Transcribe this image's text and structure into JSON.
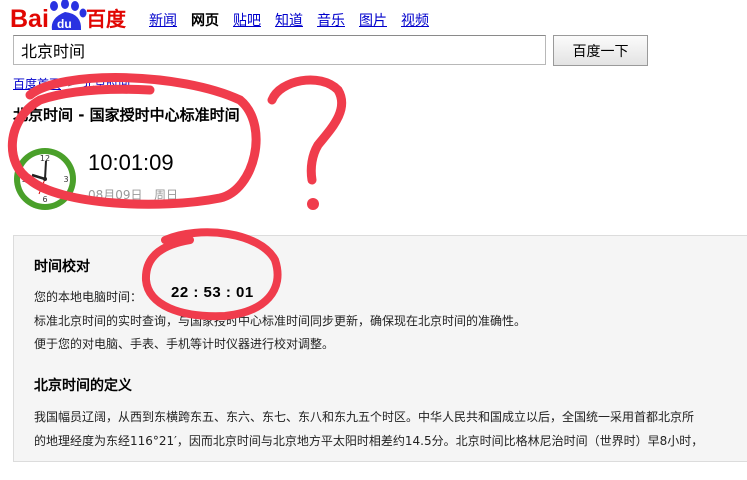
{
  "logo": {
    "text_left": "Bai",
    "text_paw": "du",
    "text_right": "百度"
  },
  "nav": [
    "新闻",
    "网页",
    "贴吧",
    "知道",
    "音乐",
    "图片",
    "视频"
  ],
  "nav_active_index": 1,
  "search": {
    "value": "北京时间",
    "button": "百度一下"
  },
  "breadcrumb": {
    "home": "百度首页",
    "current": "北京时间",
    "separator": ">"
  },
  "result": {
    "title": "北京时间 - 国家授时中心标准时间",
    "time": "10:01:09",
    "date": "08月09日",
    "weekday": "周日"
  },
  "panel": {
    "calibration_heading": "时间校对",
    "local_label": "您的本地电脑时间：",
    "local_time": "22 : 53 : 01",
    "line1": "标准北京时间的实时查询，与国家授时中心标准时间同步更新，确保现在北京时间的准确性。",
    "line2": "便于您的对电脑、手表、手机等计时仪器进行校对调整。",
    "definition_heading": "北京时间的定义",
    "def1": "我国幅员辽阔，从西到东横跨东五、东六、东七、东八和东九五个时区。中华人民共和国成立以后，全国统一采用首都北京所",
    "def2": "的地理经度为东经116°21′，因而北京时间与北京地方平太阳时相差约14.5分。北京时间比格林尼治时间（世界时）早8小时，"
  },
  "clock_numbers": {
    "n12": "12",
    "n3": "3",
    "n6": "6",
    "n9": "9"
  },
  "colors": {
    "brand_red": "#e10602",
    "brand_blue": "#2932e1",
    "link": "#0000cc",
    "scribble": "#f03c4c",
    "clock_green": "#4aa02a"
  },
  "icons": [
    "baidu-paw-logo",
    "clock-icon",
    "breadcrumb-chevron"
  ]
}
